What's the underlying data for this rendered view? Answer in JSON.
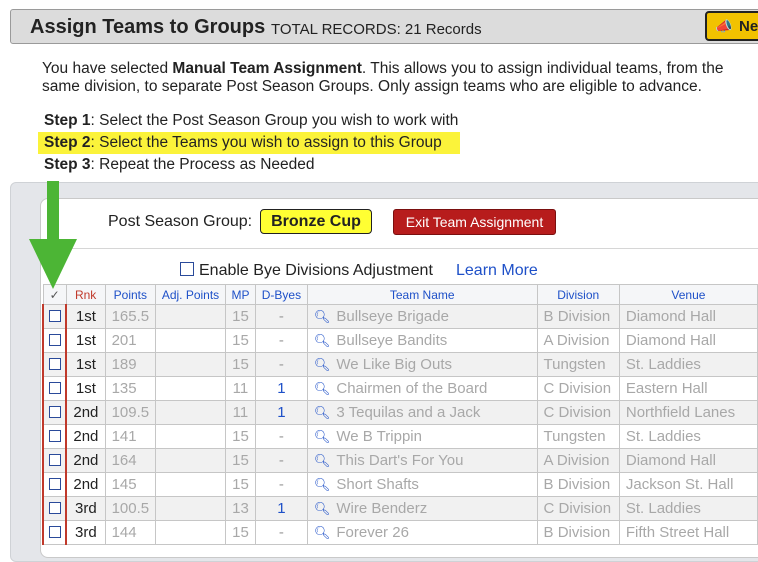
{
  "header": {
    "title": "Assign Teams to Groups",
    "records": "TOTAL RECORDS: 21 Records",
    "new_button_label": "Ne"
  },
  "intro": {
    "prefix": "You have selected ",
    "bold": "Manual Team Assignment",
    "suffix": ". This allows you to assign individual teams, from the same division, to separate Post Season Groups. Only assign teams who are eligible to advance."
  },
  "steps": [
    {
      "label": "Step 1",
      "text": ": Select the Post Season Group you wish to work with"
    },
    {
      "label": "Step 2",
      "text": ": Select the Teams you wish to assign to this Group"
    },
    {
      "label": "Step 3",
      "text": ": Repeat the Process as Needed"
    }
  ],
  "group": {
    "label": "Post Season Group:",
    "value": "Bronze Cup",
    "exit_label": "Exit Team Assignment"
  },
  "bye": {
    "label": "Enable Bye Divisions Adjustment",
    "learn_more": "Learn More"
  },
  "table": {
    "headers": {
      "check": "✓",
      "rnk": "Rnk",
      "points": "Points",
      "adj_points": "Adj. Points",
      "mp": "MP",
      "dbyes": "D-Byes",
      "team": "Team Name",
      "division": "Division",
      "venue": "Venue"
    },
    "rows": [
      {
        "rnk": "1st",
        "points": "165.5",
        "adj": "",
        "mp": "15",
        "dbyes": "-",
        "team": "Bullseye Brigade",
        "division": "B Division",
        "venue": "Diamond Hall"
      },
      {
        "rnk": "1st",
        "points": "201",
        "adj": "",
        "mp": "15",
        "dbyes": "-",
        "team": "Bullseye Bandits",
        "division": "A Division",
        "venue": "Diamond Hall"
      },
      {
        "rnk": "1st",
        "points": "189",
        "adj": "",
        "mp": "15",
        "dbyes": "-",
        "team": "We Like Big Outs",
        "division": "Tungsten",
        "venue": "St. Laddies"
      },
      {
        "rnk": "1st",
        "points": "135",
        "adj": "",
        "mp": "11",
        "dbyes": "1",
        "team": "Chairmen of the Board",
        "division": "C Division",
        "venue": "Eastern Hall"
      },
      {
        "rnk": "2nd",
        "points": "109.5",
        "adj": "",
        "mp": "11",
        "dbyes": "1",
        "team": "3 Tequilas and a Jack",
        "division": "C Division",
        "venue": "Northfield Lanes"
      },
      {
        "rnk": "2nd",
        "points": "141",
        "adj": "",
        "mp": "15",
        "dbyes": "-",
        "team": "We B Trippin",
        "division": "Tungsten",
        "venue": "St. Laddies"
      },
      {
        "rnk": "2nd",
        "points": "164",
        "adj": "",
        "mp": "15",
        "dbyes": "-",
        "team": "This Dart's For You",
        "division": "A Division",
        "venue": "Diamond Hall"
      },
      {
        "rnk": "2nd",
        "points": "145",
        "adj": "",
        "mp": "15",
        "dbyes": "-",
        "team": "Short Shafts",
        "division": "B Division",
        "venue": "Jackson St. Hall"
      },
      {
        "rnk": "3rd",
        "points": "100.5",
        "adj": "",
        "mp": "13",
        "dbyes": "1",
        "team": "Wire Benderz",
        "division": "C Division",
        "venue": "St. Laddies"
      },
      {
        "rnk": "3rd",
        "points": "144",
        "adj": "",
        "mp": "15",
        "dbyes": "-",
        "team": "Forever 26",
        "division": "B Division",
        "venue": "Fifth Street Hall"
      }
    ]
  },
  "colors": {
    "highlight": "#fbf33a",
    "arrow": "#4cb535",
    "exit_button": "#b71c1c",
    "group_badge": "#ffff33",
    "link": "#1e50c8"
  }
}
